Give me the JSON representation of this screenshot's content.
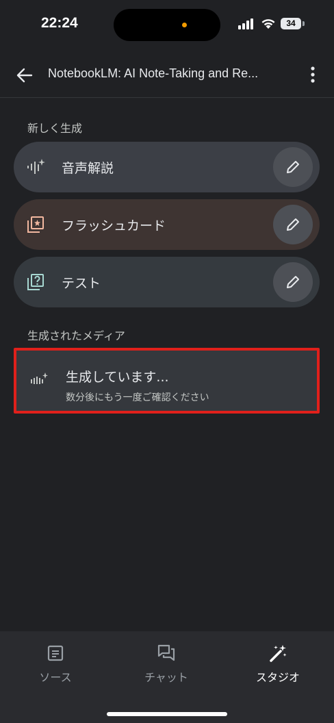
{
  "status_bar": {
    "time": "22:24",
    "battery": "34"
  },
  "app_bar": {
    "title": "NotebookLM: AI Note-Taking and Re..."
  },
  "generate_section": {
    "label": "新しく生成",
    "items": [
      {
        "label": "音声解説",
        "icon": "audio-sparkle-icon",
        "bg": "#3c3f46"
      },
      {
        "label": "フラッシュカード",
        "icon": "flashcard-icon",
        "bg": "#3e3432"
      },
      {
        "label": "テスト",
        "icon": "quiz-icon",
        "bg": "#353a3f"
      }
    ]
  },
  "media_section": {
    "label": "生成されたメディア",
    "card": {
      "title": "生成しています...",
      "subtitle": "数分後にもう一度ご確認ください",
      "icon": "audio-sparkle-icon"
    }
  },
  "bottom_nav": {
    "items": [
      {
        "label": "ソース",
        "icon": "document-icon",
        "active": false
      },
      {
        "label": "チャット",
        "icon": "chat-icon",
        "active": false
      },
      {
        "label": "スタジオ",
        "icon": "magic-wand-icon",
        "active": true
      }
    ]
  },
  "colors": {
    "background": "#202124",
    "highlight_border": "#e0201b"
  }
}
